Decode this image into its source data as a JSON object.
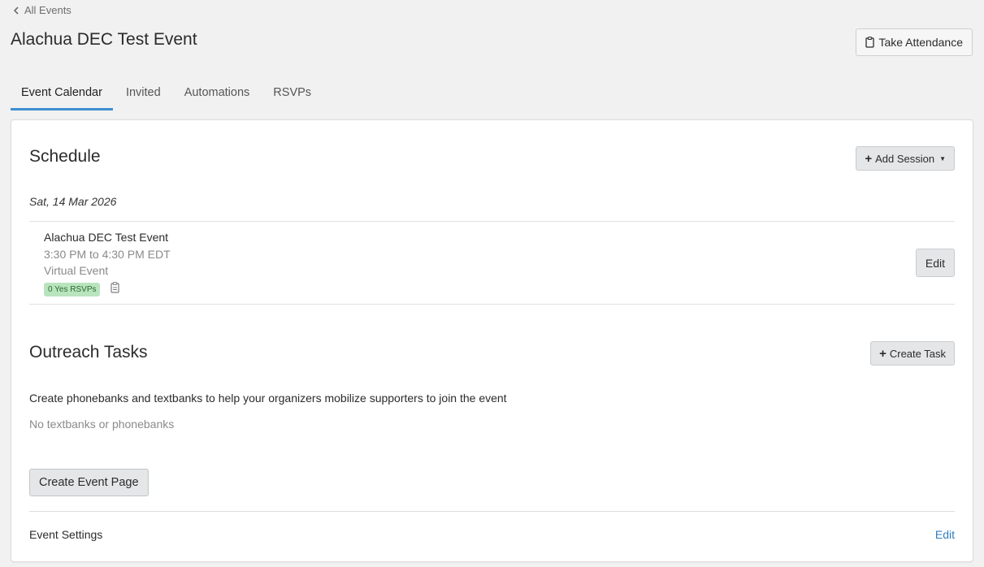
{
  "nav": {
    "back_label": "All Events"
  },
  "header": {
    "title": "Alachua DEC Test Event",
    "attendance_label": "Take Attendance"
  },
  "tabs": [
    {
      "label": "Event Calendar",
      "active": true
    },
    {
      "label": "Invited",
      "active": false
    },
    {
      "label": "Automations",
      "active": false
    },
    {
      "label": "RSVPs",
      "active": false
    }
  ],
  "schedule": {
    "title": "Schedule",
    "add_session_label": "Add Session",
    "date": "Sat, 14 Mar 2026",
    "session": {
      "name": "Alachua DEC Test Event",
      "time": "3:30 PM to 4:30 PM EDT",
      "type": "Virtual Event",
      "rsvp_badge": "0 Yes RSVPs",
      "edit_label": "Edit"
    }
  },
  "outreach": {
    "title": "Outreach Tasks",
    "create_task_label": "Create Task",
    "description": "Create phonebanks and textbanks to help your organizers mobilize supporters to join the event",
    "empty_text": "No textbanks or phonebanks"
  },
  "event_page": {
    "create_label": "Create Event Page"
  },
  "settings": {
    "label": "Event Settings",
    "edit_label": "Edit"
  },
  "colors": {
    "tab_active_underline": "#3f8fd2",
    "badge_bg": "#b9e4be",
    "link": "#2f7fc0"
  },
  "icons": {
    "back": "chevron-left-icon",
    "attendance": "clipboard-icon",
    "add": "plus-icon",
    "dropdown": "caret-down-icon"
  }
}
